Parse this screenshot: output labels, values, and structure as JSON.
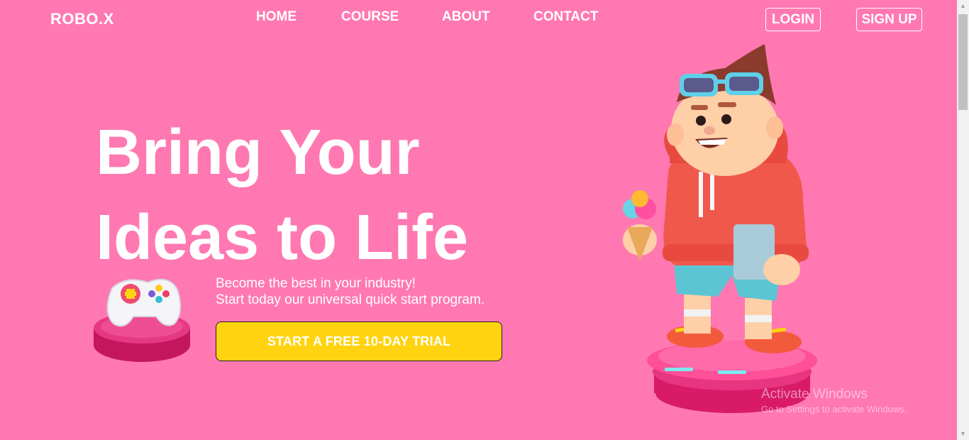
{
  "brand": {
    "logo": "ROBO.X"
  },
  "nav": {
    "items": [
      "HOME",
      "COURSE",
      "ABOUT",
      "CONTACT"
    ]
  },
  "auth": {
    "login": "LOGIN",
    "signup": "SIGN UP"
  },
  "hero": {
    "title_line1": "Bring Your",
    "title_line2": "Ideas to Life",
    "subtitle_line1": "Become the best in your industry!",
    "subtitle_line2": "Start today our universal quick start program.",
    "cta": "START A FREE 10-DAY TRIAL"
  },
  "watermark": {
    "line1": "Activate Windows",
    "line2": "Go to Settings to activate Windows."
  },
  "colors": {
    "background": "#ff78b1",
    "cta": "#ffd30f"
  },
  "icons": [
    "game-controller-icon",
    "character-illustration"
  ]
}
